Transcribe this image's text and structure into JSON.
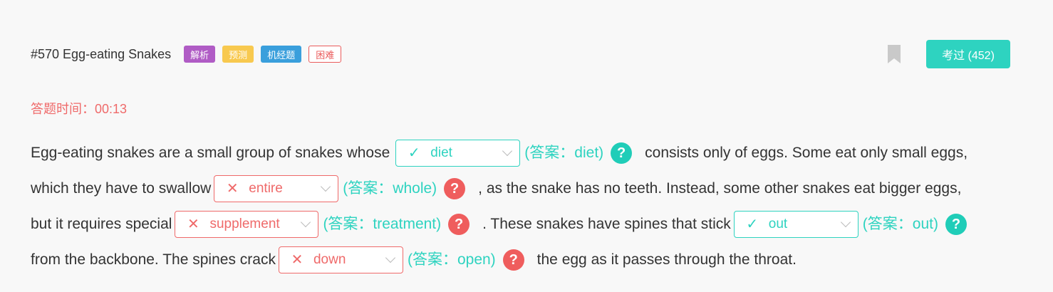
{
  "header": {
    "title": "#570 Egg-eating Snakes",
    "tags": [
      "解析",
      "预测",
      "机经题",
      "困难"
    ],
    "pass_button": "考过 (452)"
  },
  "timer": "答题时间：00:13",
  "colors": {
    "accent": "#2ed3c0",
    "error": "#ef6a6a"
  },
  "passage": {
    "t1": "Egg-eating snakes are a small group of snakes whose",
    "t2": "consists only of eggs. Some eat only small eggs,",
    "t3": "which they have to swallow",
    "t4": ", as the snake has no teeth. Instead, some other snakes eat bigger eggs,",
    "t5": "but it requires special",
    "t6": ". These snakes have spines that stick",
    "t7": "from the backbone. The spines crack",
    "t8": "the egg as it passes through the throat."
  },
  "blanks": [
    {
      "selected": "diet",
      "answer": "(答案：diet)",
      "correct": true,
      "mark": "✓"
    },
    {
      "selected": "entire",
      "answer": "(答案：whole)",
      "correct": false,
      "mark": "✕"
    },
    {
      "selected": "supplement",
      "answer": "(答案：treatment)",
      "correct": false,
      "mark": "✕"
    },
    {
      "selected": "out",
      "answer": "(答案：out)",
      "correct": true,
      "mark": "✓"
    },
    {
      "selected": "down",
      "answer": "(答案：open)",
      "correct": false,
      "mark": "✕"
    }
  ],
  "help_icon": "?"
}
